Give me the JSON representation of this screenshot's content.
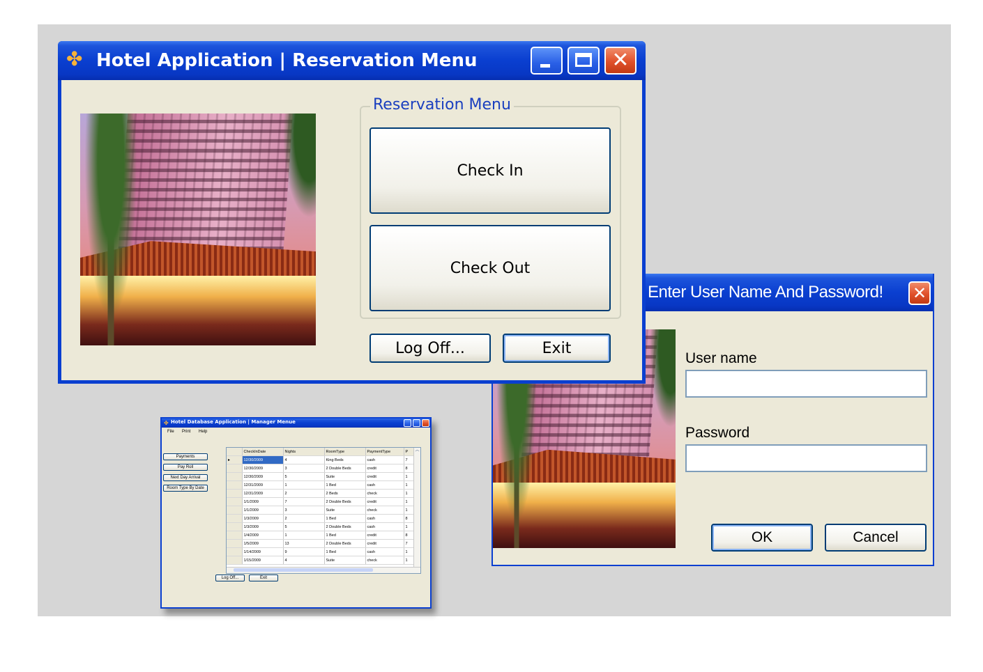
{
  "reservation_window": {
    "title": "Hotel Application |  Reservation Menu",
    "group_label": "Reservation Menu",
    "check_in_label": "Check In",
    "check_out_label": "Check Out",
    "log_off_label": "Log Off...",
    "exit_label": "Exit"
  },
  "login_dialog": {
    "title": "Enter User Name And Password!",
    "username_label": "User name",
    "username_value": "",
    "password_label": "Password",
    "password_value": "",
    "ok_label": "OK",
    "cancel_label": "Cancel"
  },
  "manager_window": {
    "title": "Hotel Database Application |  Manager Menue",
    "menu": [
      "File",
      "Print",
      "Help"
    ],
    "side_buttons": [
      "Payments",
      "Pay Roll",
      "Next Day Arrival",
      "Room Type By Date"
    ],
    "columns": [
      "CheckInDate",
      "Nights",
      "RoomType",
      "PaymentType",
      "P"
    ],
    "rows": [
      [
        "12/30/2009",
        "4",
        "King Beds",
        "cash",
        "7"
      ],
      [
        "12/30/2009",
        "3",
        "2 Double Beds",
        "credit",
        "8"
      ],
      [
        "12/30/2009",
        "5",
        "Suite",
        "credit",
        "1"
      ],
      [
        "12/31/2009",
        "1",
        "1 Bed",
        "cash",
        "1"
      ],
      [
        "12/31/2009",
        "2",
        "2 Beds",
        "check",
        "1"
      ],
      [
        "1/1/2009",
        "7",
        "2 Double Beds",
        "credit",
        "1"
      ],
      [
        "1/1/2009",
        "3",
        "Suite",
        "check",
        "1"
      ],
      [
        "1/3/2009",
        "2",
        "1 Bed",
        "cash",
        "8"
      ],
      [
        "1/3/2009",
        "5",
        "2 Double Beds",
        "cash",
        "1"
      ],
      [
        "1/4/2009",
        "1",
        "1 Bed",
        "credit",
        "8"
      ],
      [
        "1/5/2009",
        "13",
        "2 Double Beds",
        "credit",
        "7"
      ],
      [
        "1/14/2009",
        "9",
        "1 Bed",
        "cash",
        "1"
      ],
      [
        "1/15/2009",
        "4",
        "Suite",
        "check",
        "1"
      ]
    ],
    "log_off_label": "Log Off...",
    "exit_label": "Exit"
  },
  "colors": {
    "title_blue": "#0a3fd0",
    "window_face": "#ece9d8",
    "group_label_blue": "#1a3fbf"
  },
  "icons": [
    "app-icon",
    "minimize-icon",
    "maximize-icon",
    "close-icon",
    "hotel-photo"
  ]
}
